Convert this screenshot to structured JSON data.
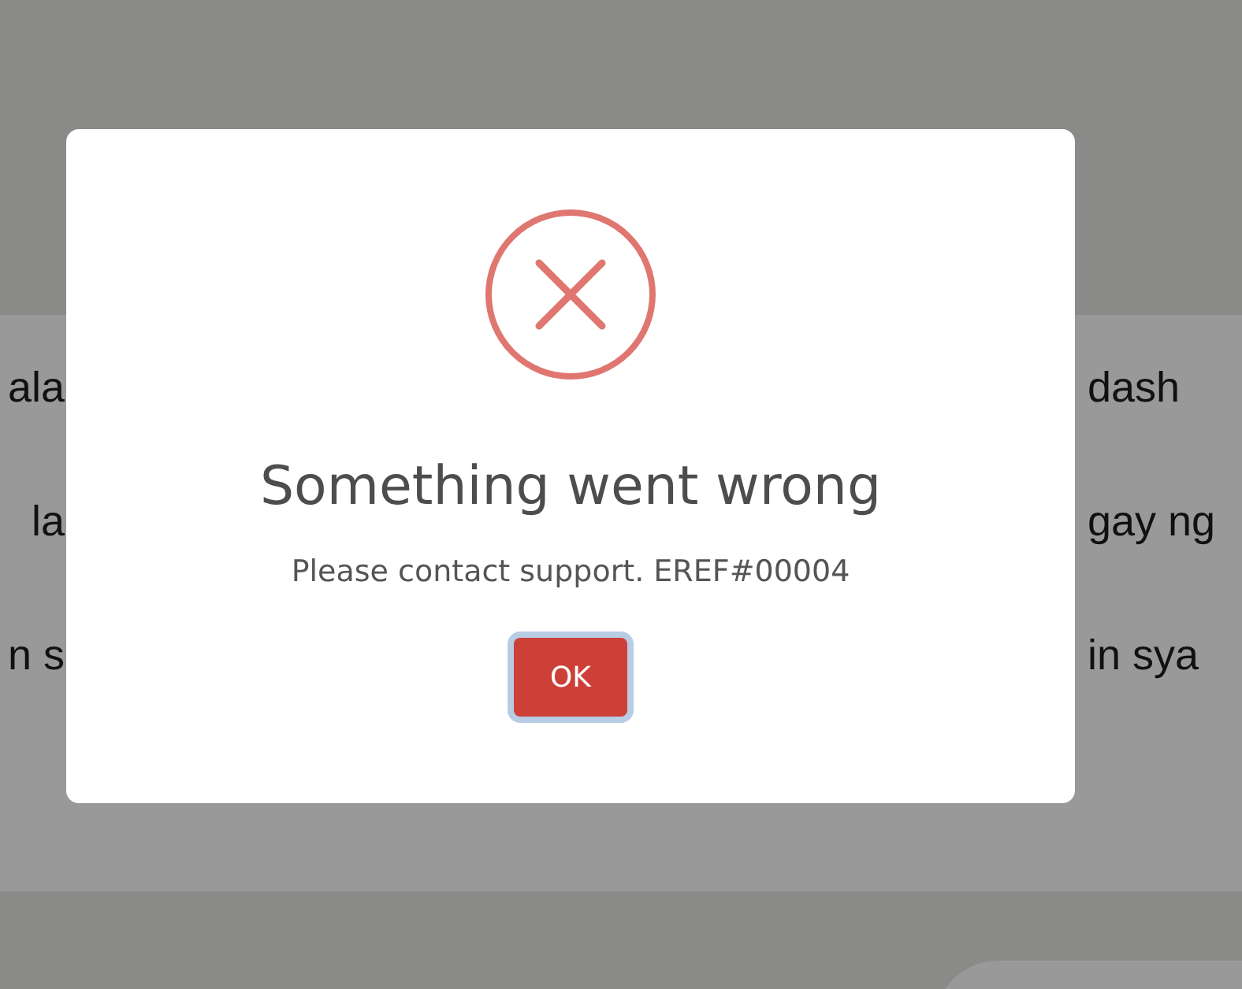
{
  "background": {
    "lines": [
      {
        "left": "ala",
        "right": "dash"
      },
      {
        "left": "la",
        "right": "gay ng"
      },
      {
        "left": "n s",
        "right": "in sya"
      }
    ]
  },
  "dialog": {
    "title": "Something went wrong",
    "message": "Please contact support. EREF#00004",
    "button": {
      "label": "OK",
      "focused": true
    }
  }
}
